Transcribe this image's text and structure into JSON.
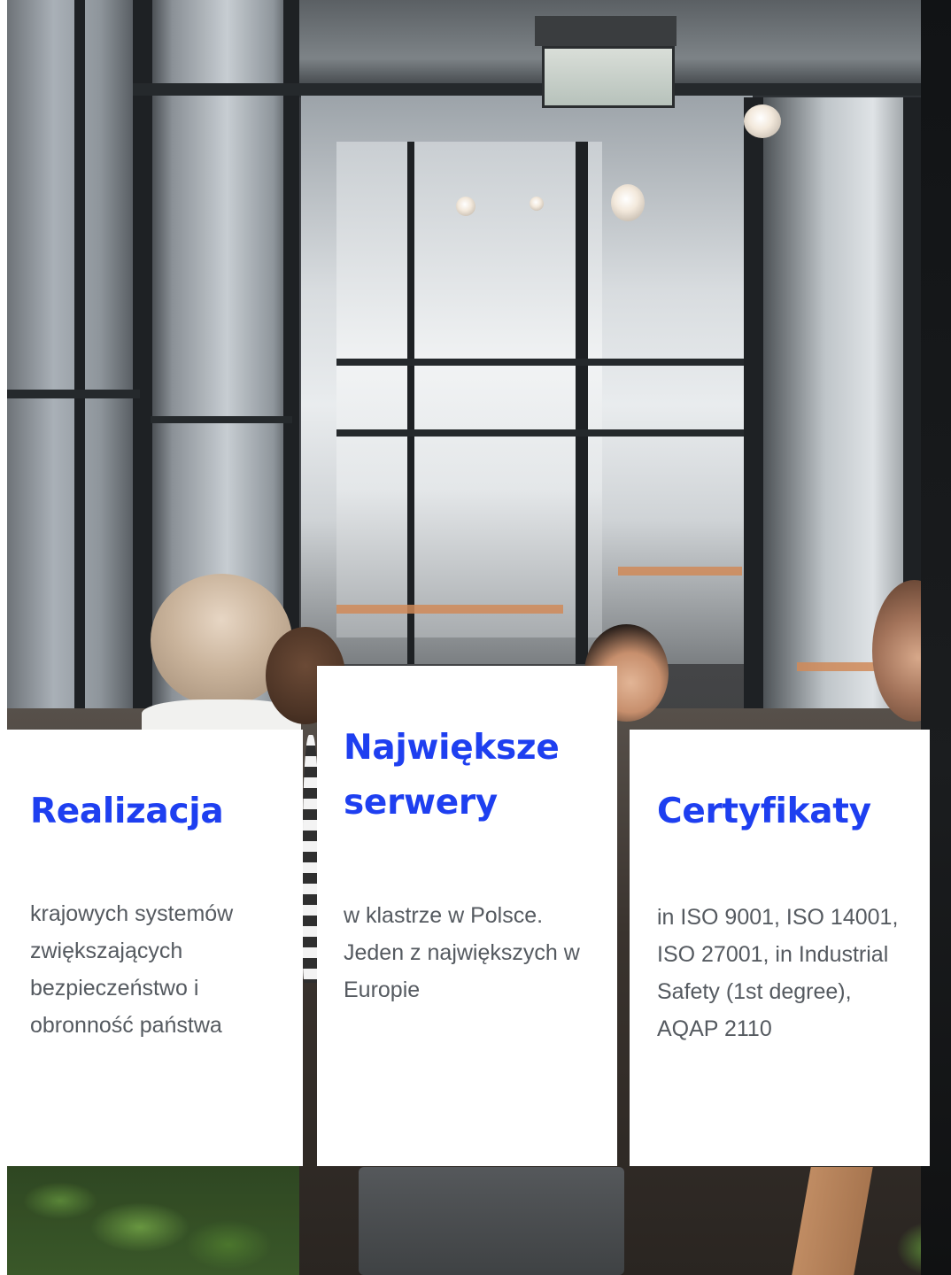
{
  "cards": [
    {
      "title": "Realizacja",
      "text": "krajowych systemów zwiększających bezpieczeństwo i obronność państwa"
    },
    {
      "title": "Największe serwery",
      "text": "w klastrze w Polsce. Jeden z największych w Europie"
    },
    {
      "title": "Certyfikaty",
      "text": "in ISO 9001, ISO 14001, ISO 27001, in Industrial Safety (1st degree), AQAP 2110"
    }
  ],
  "colors": {
    "title": "#1e3ff0",
    "text": "#555a60",
    "card_bg": "#ffffff"
  }
}
